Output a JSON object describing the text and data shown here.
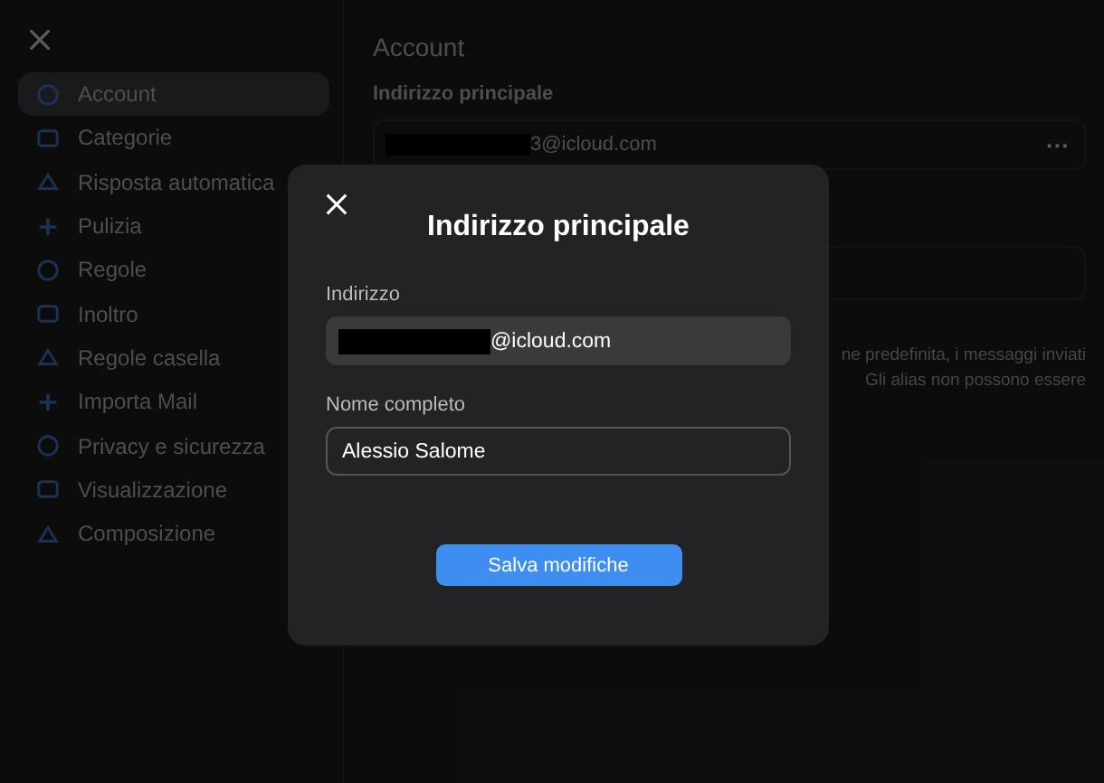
{
  "sidebar": {
    "items": [
      {
        "label": "Account",
        "selected": true
      },
      {
        "label": "Categorie",
        "selected": false
      },
      {
        "label": "Risposta automatica",
        "selected": false
      },
      {
        "label": "Pulizia",
        "selected": false
      },
      {
        "label": "Regole",
        "selected": false
      },
      {
        "label": "Inoltro",
        "selected": false
      },
      {
        "label": "Regole casella",
        "selected": false
      },
      {
        "label": "Importa Mail",
        "selected": false
      },
      {
        "label": "Privacy e sicurezza",
        "selected": false
      },
      {
        "label": "Visualizzazione",
        "selected": false
      },
      {
        "label": "Composizione",
        "selected": false
      }
    ]
  },
  "main": {
    "title": "Account",
    "section": "Indirizzo principale",
    "address": "3@icloud.com",
    "more": "···",
    "description": [
      "ne predefinita, i messaggi inviati",
      "Gli alias non possono essere"
    ]
  },
  "dialog": {
    "title": "Indirizzo principale",
    "fields": [
      {
        "label": "Indirizzo",
        "value": "@icloud.com",
        "kind": "readonly",
        "redacted": true
      },
      {
        "label": "Nome completo",
        "value": "Alessio Salome",
        "kind": "editable",
        "redacted": false
      }
    ],
    "button": "Salva modifiche"
  }
}
